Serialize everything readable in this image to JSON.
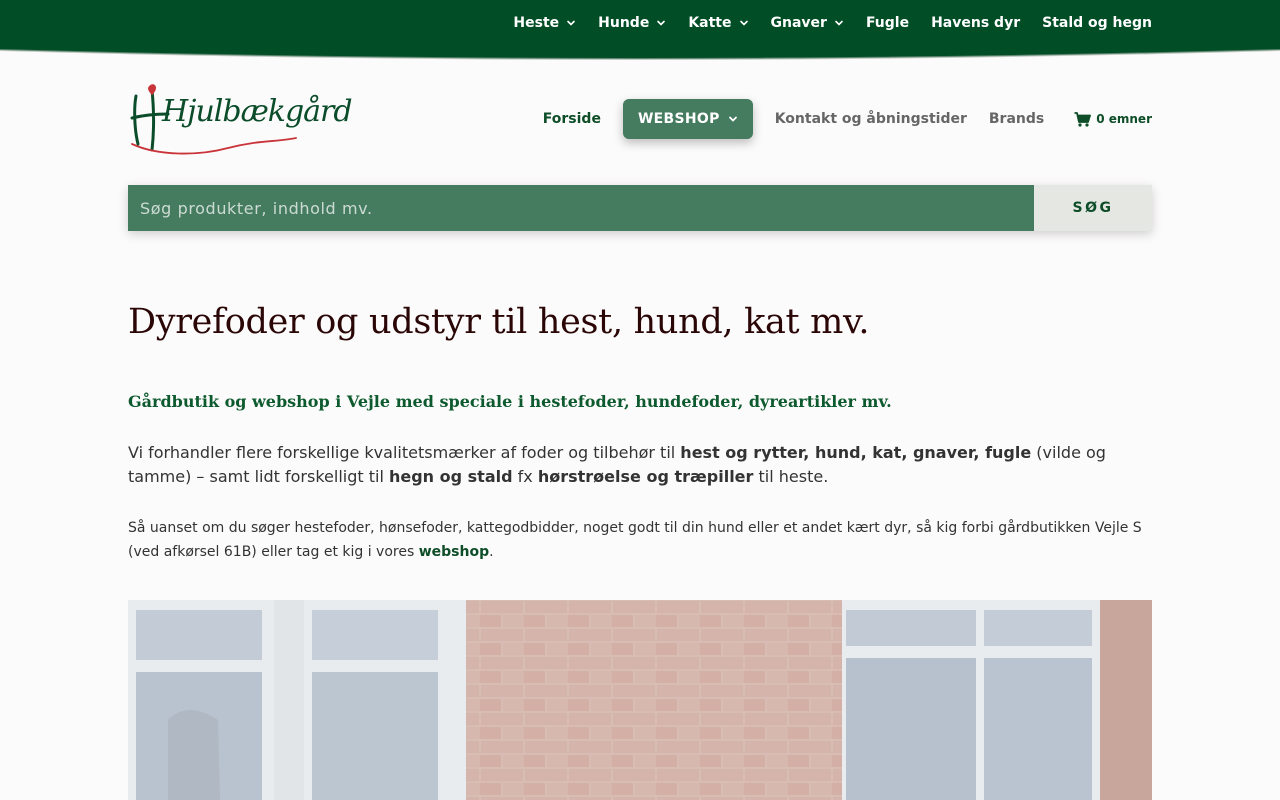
{
  "top_nav": [
    {
      "label": "Heste",
      "has_dropdown": true
    },
    {
      "label": "Hunde",
      "has_dropdown": true
    },
    {
      "label": "Katte",
      "has_dropdown": true
    },
    {
      "label": "Gnaver",
      "has_dropdown": true
    },
    {
      "label": "Fugle",
      "has_dropdown": false
    },
    {
      "label": "Havens dyr",
      "has_dropdown": false
    },
    {
      "label": "Stald og hegn",
      "has_dropdown": false
    }
  ],
  "logo": {
    "text": "Hjulbækgård"
  },
  "main_nav": {
    "home": "Forside",
    "webshop": "WEBSHOP",
    "contact": "Kontakt og åbningstider",
    "brands": "Brands",
    "cart": "0 emner"
  },
  "search": {
    "placeholder": "Søg produkter, indhold mv.",
    "button": "SØG"
  },
  "content": {
    "headline": "Dyrefoder og udstyr til hest, hund, kat mv.",
    "subhead": "Gårdbutik og webshop i Vejle med speciale i hestefoder, hundefoder, dyreartikler mv.",
    "p1": {
      "t1": "Vi forhandler flere forskellige kvalitetsmærker af foder og tilbehør til ",
      "b1": "hest og rytter, hund, kat, gnaver, fugle",
      "t2": " (vilde og tamme) – samt lidt forskelligt til ",
      "b2": "hegn og stald",
      "t3": " fx ",
      "b3": "hørstrøelse og træpiller",
      "t4": " til heste."
    },
    "p2": {
      "text": "Så uanset om du søger hestefoder, hønsefoder, kattegodbidder, noget godt til din hund eller et andet kært dyr, så kig forbi gårdbutikken Vejle S (ved afkørsel 61B) eller tag et kig i vores ",
      "link": "webshop",
      "end": "."
    }
  },
  "colors": {
    "top_bar": "#004d26",
    "brand_green": "#0d4d27",
    "button_green": "#457c5f",
    "search_button_bg": "#e5e7e3",
    "headline": "#2a0606"
  }
}
